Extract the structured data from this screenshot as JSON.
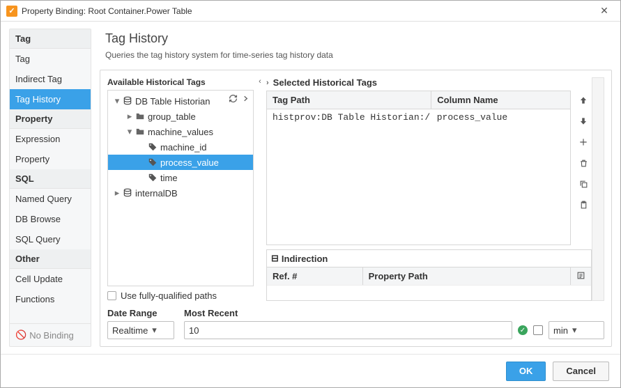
{
  "window": {
    "title": "Property Binding: Root Container.Power Table",
    "app_icon_glyph": "✓"
  },
  "sidebar": {
    "groups": [
      {
        "header": "Tag",
        "items": [
          "Tag",
          "Indirect Tag",
          "Tag History"
        ]
      },
      {
        "header": "Property",
        "items": [
          "Expression",
          "Property"
        ]
      },
      {
        "header": "SQL",
        "items": [
          "Named Query",
          "DB Browse",
          "SQL Query"
        ]
      },
      {
        "header": "Other",
        "items": [
          "Cell Update",
          "Functions"
        ]
      }
    ],
    "active": "Tag History",
    "no_binding_label": "No Binding"
  },
  "main": {
    "title": "Tag History",
    "subtitle": "Queries the tag history system for time-series tag history data"
  },
  "available": {
    "label": "Available Historical Tags",
    "tree": [
      {
        "level": 0,
        "expand": "▾",
        "icon": "db",
        "label": "DB Table Historian"
      },
      {
        "level": 1,
        "expand": "▸",
        "icon": "folder",
        "label": "group_table"
      },
      {
        "level": 1,
        "expand": "▾",
        "icon": "folder",
        "label": "machine_values"
      },
      {
        "level": 2,
        "expand": "",
        "icon": "tag",
        "label": "machine_id"
      },
      {
        "level": 2,
        "expand": "",
        "icon": "tag",
        "label": "process_value",
        "selected": true
      },
      {
        "level": 2,
        "expand": "",
        "icon": "tag",
        "label": "time"
      },
      {
        "level": 0,
        "expand": "▸",
        "icon": "db",
        "label": "internalDB"
      }
    ],
    "fully_qualified_label": "Use fully-qualified paths"
  },
  "selected": {
    "label": "Selected Historical Tags",
    "columns": [
      "Tag Path",
      "Column Name"
    ],
    "rows": [
      {
        "tag_path": "histprov:DB Table Historian:/tabl",
        "column_name": "process_value"
      }
    ]
  },
  "indirection": {
    "label": "Indirection",
    "columns": [
      "Ref. #",
      "Property Path"
    ]
  },
  "date": {
    "range_label": "Date Range",
    "mode": "Realtime",
    "most_recent_label": "Most Recent",
    "most_recent_value": "10",
    "unit": "min"
  },
  "footer": {
    "ok": "OK",
    "cancel": "Cancel"
  }
}
